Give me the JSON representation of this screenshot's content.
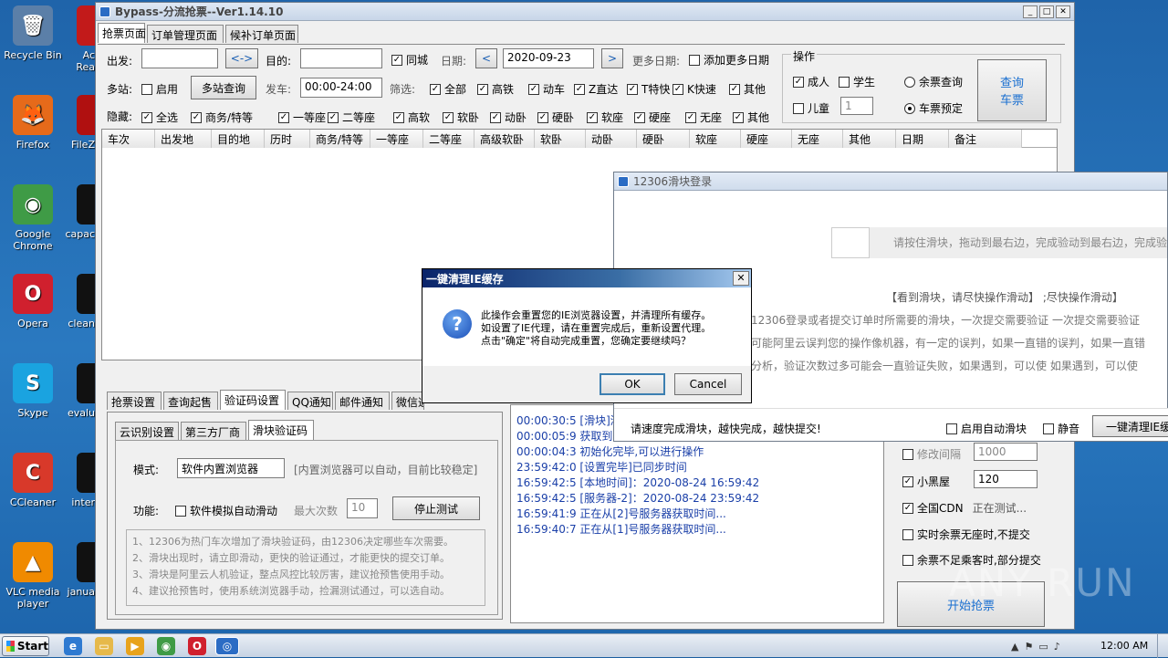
{
  "desktop_icons": [
    {
      "label": "Recycle Bin",
      "icon": "recycle-bin-icon",
      "glyph": "🗑",
      "color": "#5b7fa8"
    },
    {
      "label": "Firefox",
      "icon": "firefox-icon",
      "glyph": "🦊",
      "color": "#e66a1a"
    },
    {
      "label": "Google Chrome",
      "icon": "chrome-icon",
      "glyph": "◉",
      "color": "#3f9b46"
    },
    {
      "label": "Opera",
      "icon": "opera-icon",
      "glyph": "O",
      "color": "#d0202e"
    },
    {
      "label": "Skype",
      "icon": "skype-icon",
      "glyph": "S",
      "color": "#1aa3e0"
    },
    {
      "label": "CCleaner",
      "icon": "ccleaner-icon",
      "glyph": "C",
      "color": "#d8392a"
    },
    {
      "label": "VLC media player",
      "icon": "vlc-icon",
      "glyph": "▲",
      "color": "#f08a00"
    }
  ],
  "desktop_icons_col2": [
    {
      "label": "Ac\nRea",
      "color": "#c21a1a"
    },
    {
      "label": "FileZ",
      "color": "#b01010"
    },
    {
      "label": "capac",
      "color": "#111"
    },
    {
      "label": "clean",
      "color": "#111"
    },
    {
      "label": "evalu",
      "color": "#111"
    },
    {
      "label": "inter",
      "color": "#111"
    },
    {
      "label": "janua",
      "color": "#111"
    }
  ],
  "main": {
    "title": "Bypass-分流抢票--Ver1.14.10",
    "tabs": [
      "抢票页面",
      "订单管理页面",
      "候补订单页面"
    ],
    "row1": {
      "from_label": "出发:",
      "swap": "<->",
      "to_label": "目的:",
      "same_city": "同城",
      "date_label": "日期:",
      "date": "2020-09-23",
      "more_dates_label": "更多日期:",
      "add_more": "添加更多日期"
    },
    "row2": {
      "multi_label": "多站:",
      "enable": "启用",
      "multi_query": "多站查询",
      "depart_label": "发车:",
      "time": "00:00-24:00",
      "filter_label": "筛选:",
      "filters": [
        "全部",
        "高铁",
        "动车",
        "Z直达",
        "T特快",
        "K快速",
        "其他"
      ]
    },
    "row3": {
      "hide_label": "隐藏:",
      "items": [
        "全选",
        "商务/特等",
        "一等座",
        "二等座",
        "高软",
        "软卧",
        "动卧",
        "硬卧",
        "软座",
        "硬座",
        "无座",
        "其他"
      ]
    },
    "ops": {
      "title": "操作",
      "adult": "成人",
      "student": "学生",
      "child": "儿童",
      "child_count": "1",
      "remain_query": "余票查询",
      "book": "车票预定",
      "query_btn": "查询\n车票"
    },
    "columns": [
      "车次",
      "出发地",
      "目的地",
      "历时",
      "商务/特等",
      "一等座",
      "二等座",
      "高级软卧",
      "软卧",
      "动卧",
      "硬卧",
      "软座",
      "硬座",
      "无座",
      "其他",
      "日期",
      "备注"
    ],
    "bottom_tabs": [
      "抢票设置",
      "查询起售",
      "验证码设置",
      "QQ通知",
      "邮件通知",
      "微信通"
    ],
    "sub_tabs": [
      "云识别设置",
      "第三方厂商",
      "滑块验证码"
    ],
    "mode_label": "模式:",
    "mode_value": "软件内置浏览器",
    "mode_hint": "[内置浏览器可以自动，目前比较稳定]",
    "func_label": "功能:",
    "auto_slide": "软件模拟自动滑动",
    "max_label": "最大次数",
    "max_value": "10",
    "stop_test": "停止测试",
    "notes": [
      "1、12306为热门车次增加了滑块验证码，由12306决定哪些车次需要。",
      "2、滑块出现时，请立即滑动，更快的验证通过，才能更快的提交订单。",
      "3、滑块是阿里云人机验证，整点风控比较厉害，建议抢预售使用手动。",
      "4、建议抢预售时，使用系统浏览器手动，捡漏测试通过，可以选自动。"
    ],
    "logs": [
      "00:00:30:5  [滑块]测",
      "00:00:05:9  获取到:8",
      "00:00:04:3  初始化完毕,可以进行操作",
      "23:59:42:0  [设置完毕]已同步时间",
      "16:59:42:5  [本地时间]：2020-08-24 16:59:42",
      "16:59:42:5  [服务器-2]：2020-08-24 23:59:42",
      "16:59:41:9  正在从[2]号服务器获取时间...",
      "16:59:40:7  正在从[1]号服务器获取时间..."
    ],
    "right_opts": {
      "modify_interval": "修改间隔",
      "interval_val": "1000",
      "blackroom": "小黑屋",
      "blackroom_val": "120",
      "cdn": "全国CDN",
      "cdn_status": "正在测试...",
      "realtime": "实时余票无座时,不提交",
      "partial": "余票不足乘客时,部分提交",
      "start": "开始抢票"
    }
  },
  "slider": {
    "title": "12306滑块登录",
    "prompt": "请按住滑块，拖动到最右边，完成验动到最右边，完成验",
    "hint": "【看到滑块，请尽快操作滑动】  ;尽快操作滑动】",
    "desc1": "12306登录或者提交订单时所需要的滑块，一次提交需要验证  一次提交需要验证",
    "desc2": "可能阿里云误判您的操作像机器，有一定的误判，如果一直错的误判，如果一直错",
    "desc3": "分析，验证次数过多可能会一直验证失败，如果遇到，可以使  如果遇到，可以使",
    "footer": "请速度完成滑块，越快完成，越快提交!",
    "auto_slide": "启用自动滑块",
    "mute": "静音",
    "clear_ie": "一键清理IE缓"
  },
  "dialog": {
    "title": "一键清理IE缓存",
    "line1": "此操作会重置您的IE浏览器设置，并清理所有缓存。",
    "line2": "如设置了IE代理，请在重置完成后，重新设置代理。",
    "line3": "点击\"确定\"将自动完成重置，您确定要继续吗？",
    "ok": "OK",
    "cancel": "Cancel"
  },
  "taskbar": {
    "start": "Start",
    "time": "12:00 AM"
  },
  "watermark": "ANY RUN"
}
